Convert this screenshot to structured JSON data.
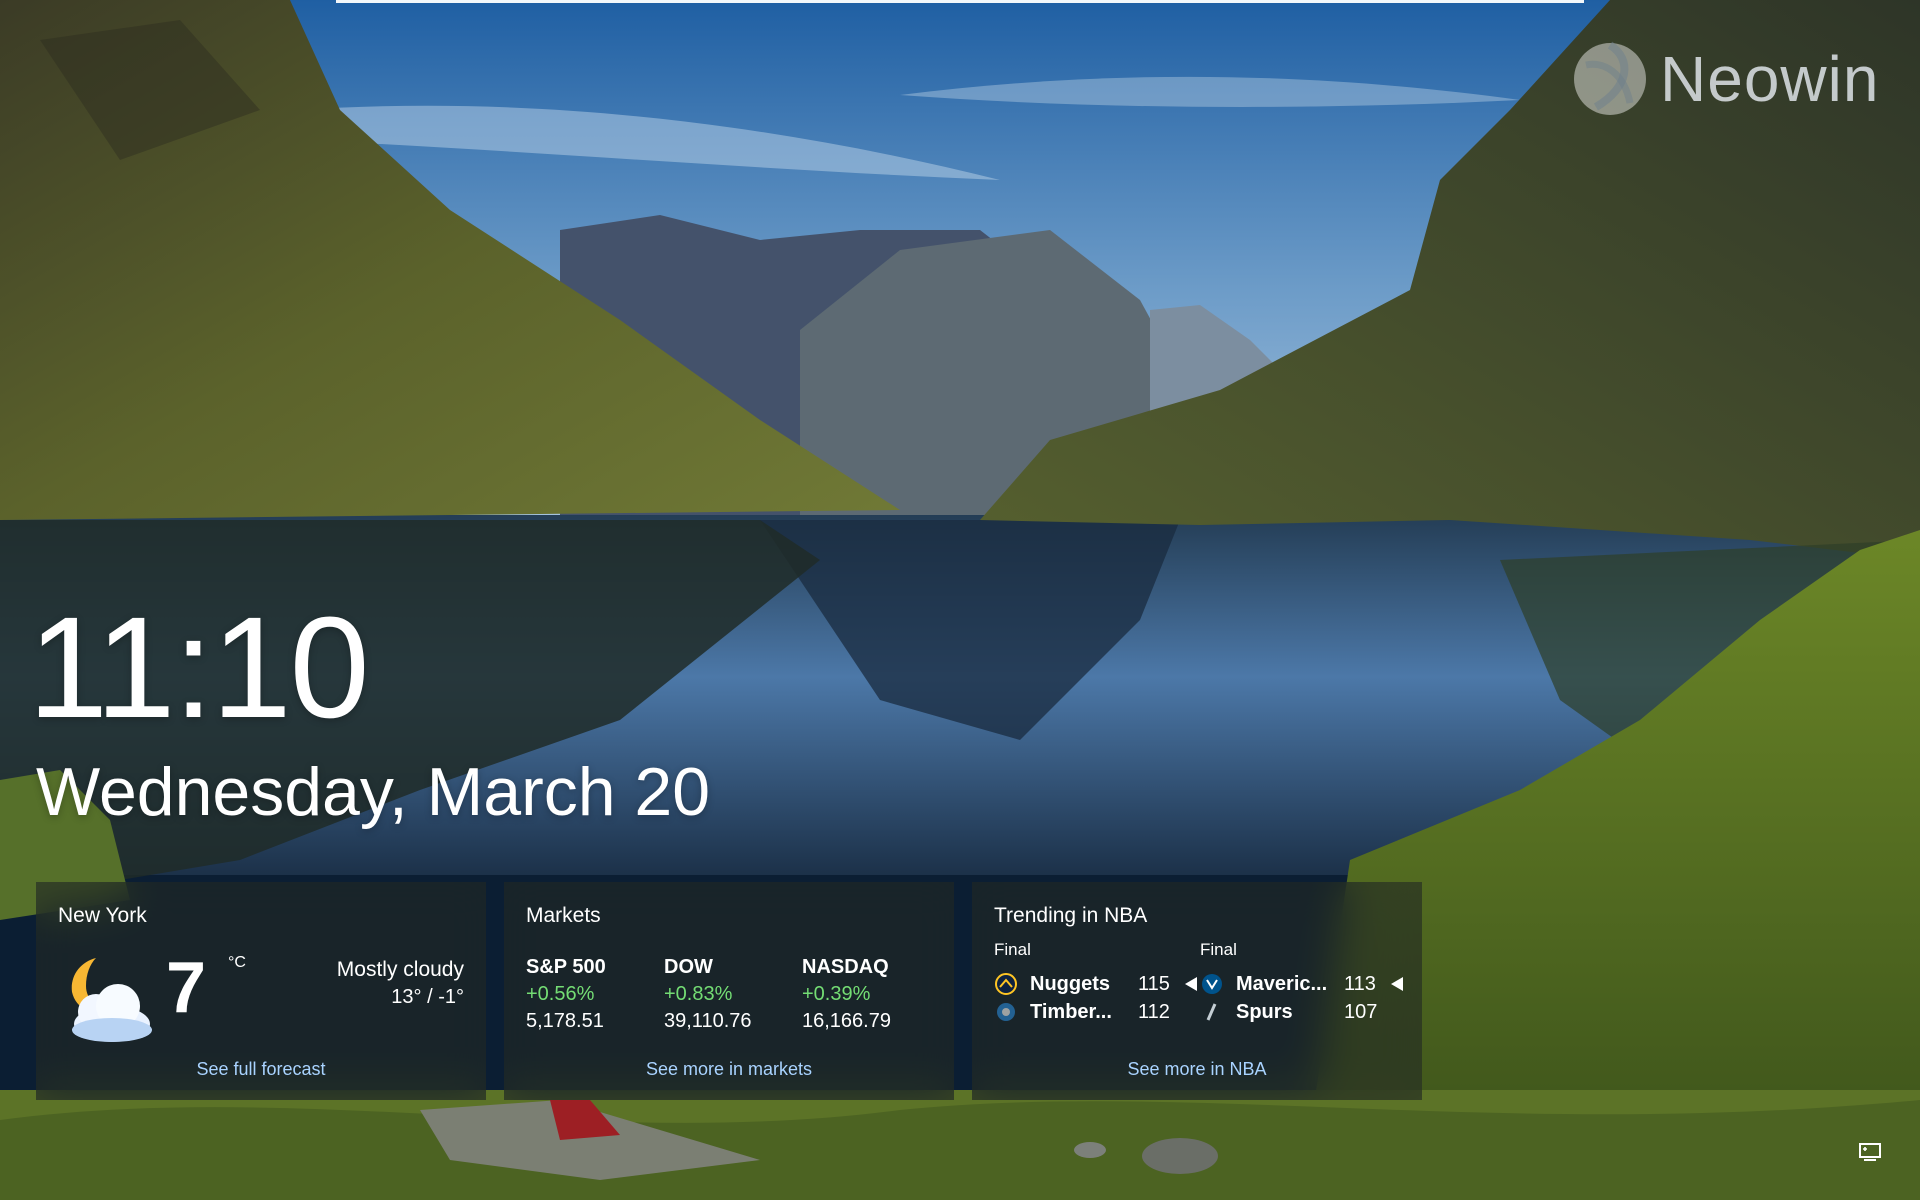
{
  "colors": {
    "link": "#a9d3ff",
    "positive_change": "#74dd74",
    "card_background": "rgba(34, 40, 36, 0.62)"
  },
  "watermark": {
    "text": "Neowin",
    "icon": "neowin-logo-icon"
  },
  "lock_screen": {
    "time": "11:10",
    "date": "Wednesday, March 20"
  },
  "weather": {
    "title": "New York",
    "icon": "partly-cloudy-night-icon",
    "temperature": "7",
    "unit": "°C",
    "condition": "Mostly cloudy",
    "range": "13° / -1°",
    "link": "See full forecast"
  },
  "markets": {
    "title": "Markets",
    "items": [
      {
        "name": "S&P 500",
        "change": "+0.56%",
        "value": "5,178.51"
      },
      {
        "name": "DOW",
        "change": "+0.83%",
        "value": "39,110.76"
      },
      {
        "name": "NASDAQ",
        "change": "+0.39%",
        "value": "16,166.79"
      }
    ],
    "link": "See more in markets"
  },
  "nba": {
    "title": "Trending in NBA",
    "games": [
      {
        "status": "Final",
        "teams": [
          {
            "name": "Nuggets",
            "score": "115",
            "winner": true,
            "logo": "nuggets-logo-icon"
          },
          {
            "name": "Timber...",
            "score": "112",
            "winner": false,
            "logo": "timberwolves-logo-icon"
          }
        ]
      },
      {
        "status": "Final",
        "teams": [
          {
            "name": "Maveric...",
            "score": "113",
            "winner": true,
            "logo": "mavericks-logo-icon"
          },
          {
            "name": "Spurs",
            "score": "107",
            "winner": false,
            "logo": "spurs-logo-icon"
          }
        ]
      }
    ],
    "link": "See more in NBA"
  },
  "system": {
    "icon": "network-connection-icon"
  }
}
